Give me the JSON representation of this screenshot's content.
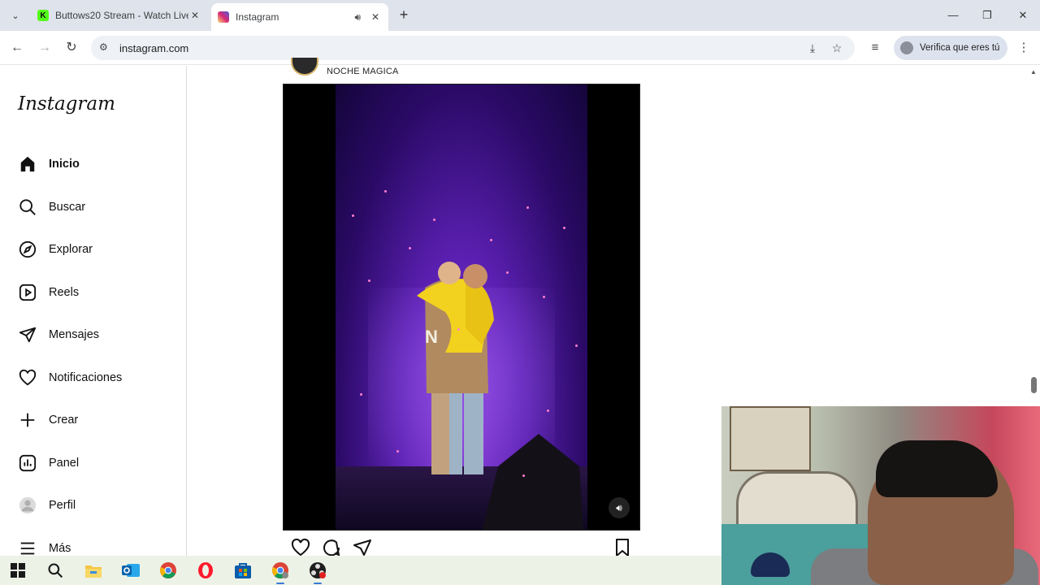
{
  "browser": {
    "tabs": [
      {
        "title": "Buttows20 Stream - Watch Live",
        "favicon_color": "#53fc18",
        "active": false
      },
      {
        "title": "Instagram",
        "favicon_color": "#d62976",
        "active": true
      }
    ],
    "url": "instagram.com",
    "profile_label": "Verifica que eres tú"
  },
  "instagram": {
    "logo": "Instagram",
    "nav": [
      {
        "label": "Inicio",
        "icon": "home-icon",
        "active": true
      },
      {
        "label": "Buscar",
        "icon": "search-icon"
      },
      {
        "label": "Explorar",
        "icon": "compass-icon"
      },
      {
        "label": "Reels",
        "icon": "reels-icon"
      },
      {
        "label": "Mensajes",
        "icon": "send-icon"
      },
      {
        "label": "Notificaciones",
        "icon": "heart-icon"
      },
      {
        "label": "Crear",
        "icon": "plus-icon"
      },
      {
        "label": "Panel",
        "icon": "chart-icon"
      },
      {
        "label": "Perfil",
        "icon": "avatar-icon"
      },
      {
        "label": "Más",
        "icon": "menu-icon"
      }
    ],
    "post": {
      "username": "NOCHE MAGICA"
    }
  },
  "taskbar": {
    "apps": [
      "windows-start",
      "search",
      "file-explorer",
      "outlook",
      "chrome",
      "opera",
      "microsoft-store",
      "chrome-profile",
      "obs"
    ]
  }
}
